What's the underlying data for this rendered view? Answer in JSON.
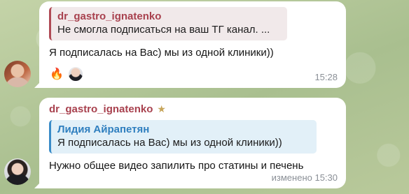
{
  "messages": [
    {
      "reply": {
        "author": "dr_gastro_ignatenko",
        "text": "Не смогла подписаться на ваш ТГ канал. ..."
      },
      "text": "Я подписалась на Вас) мы из одной клиники))",
      "reactions": [
        "🔥"
      ],
      "time": "15:28"
    },
    {
      "sender": "dr_gastro_ignatenko",
      "reply": {
        "author": "Лидия Айрапетян",
        "text": "Я подписалась на Вас) мы из одной клиники))"
      },
      "text": "Нужно общее видео запилить про статины и печень",
      "time": "изменено 15:30"
    }
  ]
}
